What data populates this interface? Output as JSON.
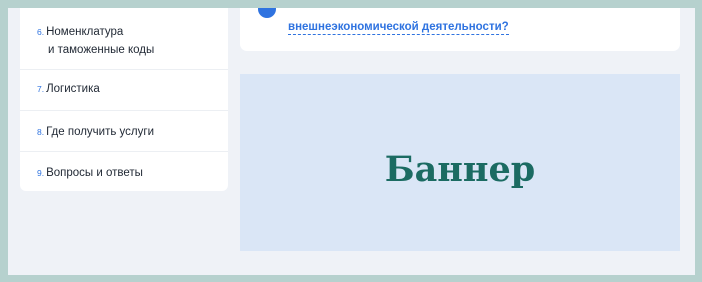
{
  "sidebar": {
    "items": [
      {
        "number": "6.",
        "label_line1": "Номенклатура",
        "label_line2": "и таможенные коды"
      },
      {
        "number": "7.",
        "label": "Логистика"
      },
      {
        "number": "8.",
        "label": "Где получить услуги"
      },
      {
        "number": "9.",
        "label": "Вопросы и ответы"
      }
    ]
  },
  "question_card": {
    "icon": "circle-icon",
    "link_text": "внешнеэкономической деятельности?"
  },
  "banner": {
    "text": "Баннер"
  },
  "colors": {
    "outer_border": "#b6d1ce",
    "page_bg": "#eff2f7",
    "accent": "#2f73e0",
    "banner_bg": "#dae6f6",
    "banner_text": "#1b6b62"
  }
}
